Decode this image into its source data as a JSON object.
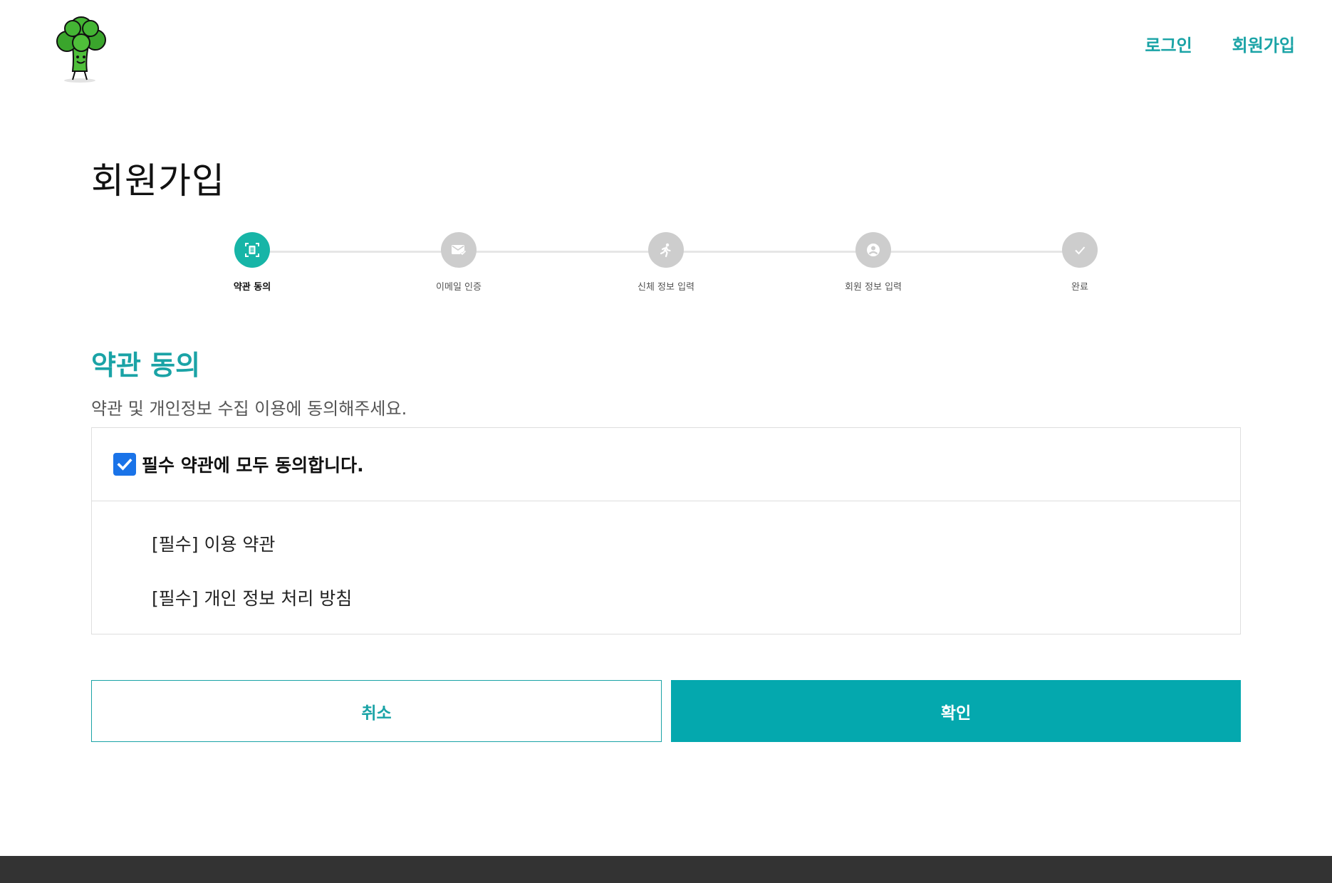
{
  "header": {
    "logo_icon": "broccoli-mascot-icon",
    "nav": {
      "login": "로그인",
      "signup": "회원가입"
    }
  },
  "page_title": "회원가입",
  "stepper": {
    "steps": [
      {
        "label": "약관 동의",
        "icon": "document-icon",
        "active": true
      },
      {
        "label": "이메일 인증",
        "icon": "mail-check-icon",
        "active": false
      },
      {
        "label": "신체 정보 입력",
        "icon": "running-person-icon",
        "active": false
      },
      {
        "label": "회원 정보 입력",
        "icon": "user-circle-icon",
        "active": false
      },
      {
        "label": "완료",
        "icon": "check-icon",
        "active": false
      }
    ]
  },
  "section": {
    "heading": "약관 동의",
    "description": "약관 및 개인정보 수집 이용에 동의해주세요."
  },
  "terms": {
    "agree_all_label": "필수 약관에 모두 동의합니다.",
    "agree_all_checked": true,
    "items": [
      "[필수] 이용 약관",
      "[필수] 개인 정보 처리 방침"
    ]
  },
  "buttons": {
    "cancel": "취소",
    "confirm": "확인"
  },
  "colors": {
    "accent": "#1aa3a6",
    "confirm_bg": "#04a8ae",
    "step_active": "#17b5a7",
    "step_inactive": "#cdcdcd",
    "checkbox": "#1a73e8",
    "footer": "#333333"
  }
}
